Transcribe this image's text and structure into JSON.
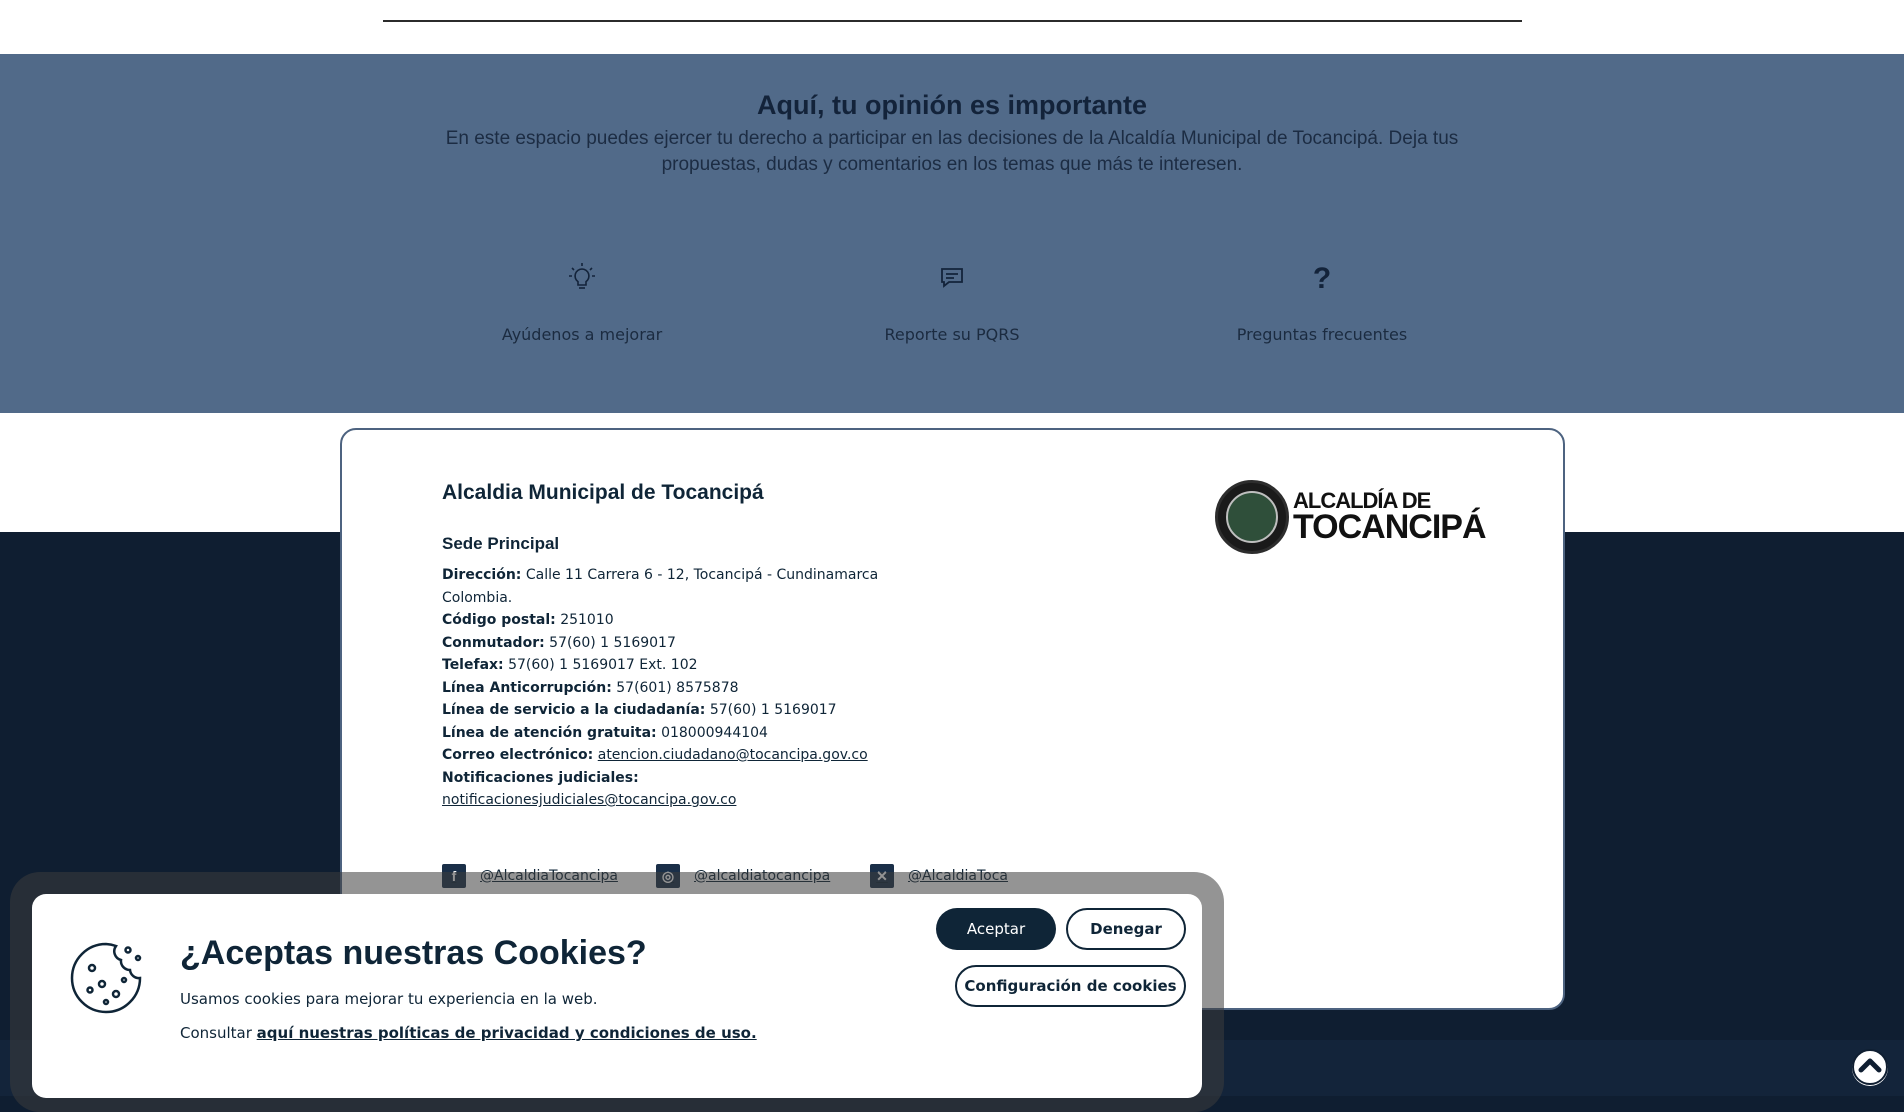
{
  "opinion": {
    "title": "Aquí, tu opinión es importante",
    "description": "En este espacio puedes ejercer tu derecho a participar en las decisiones de la Alcaldía Municipal de Tocancipá. Deja tus propuestas, dudas y comentarios en los temas que más te interesen.",
    "options": [
      {
        "label": "Ayúdenos a mejorar",
        "icon": "lightbulb-icon"
      },
      {
        "label": "Reporte su PQRS",
        "icon": "chat-icon"
      },
      {
        "label": "Preguntas frecuentes",
        "icon": "question-icon"
      }
    ]
  },
  "footer": {
    "title": "Alcaldia Municipal de Tocancipá",
    "subtitle": "Sede Principal",
    "logo": {
      "line1": "ALCALDÍA DE",
      "line2": "TOCANCIPÁ"
    },
    "info": {
      "direccion_label": "Dirección:",
      "direccion_value": "Calle 11 Carrera 6 - 12, Tocancipá - Cundinamarca",
      "direccion_value2": "Colombia.",
      "postal_label": "Código postal:",
      "postal_value": "251010",
      "conmutador_label": "Conmutador:",
      "conmutador_value": "57(60) 1 5169017",
      "telefax_label": "Telefax:",
      "telefax_value": "57(60) 1 5169017 Ext. 102",
      "anticorrupcion_label": "Línea Anticorrupción:",
      "anticorrupcion_value": "57(601) 8575878",
      "servicio_label": "Línea de servicio a la ciudadanía:",
      "servicio_value": "57(60) 1 5169017",
      "gratuita_label": "Línea de atención gratuita:",
      "gratuita_value": "018000944104",
      "correo_label": "Correo electrónico:",
      "correo_value": "atencion.ciudadano@tocancipa.gov.co",
      "notif_label": "Notificaciones judiciales:",
      "notif_value": "notificacionesjudiciales@tocancipa.gov.co"
    },
    "socials": [
      {
        "glyph": "f",
        "handle": "@AlcaldiaTocancipa",
        "icon": "facebook-icon"
      },
      {
        "glyph": "◎",
        "handle": "@alcaldiatocancipa",
        "icon": "instagram-icon"
      },
      {
        "glyph": "✕",
        "handle": "@AlcaldiaToca",
        "icon": "x-twitter-icon"
      }
    ]
  },
  "cookies": {
    "title": "¿Aceptas nuestras Cookies?",
    "text": "Usamos cookies para mejorar tu experiencia en la web.",
    "link_prefix": "Consultar",
    "link_text": "aquí nuestras políticas de privacidad y condiciones de uso.",
    "accept_label": "Aceptar",
    "deny_label": "Denegar",
    "config_label": "Configuración de cookies"
  }
}
